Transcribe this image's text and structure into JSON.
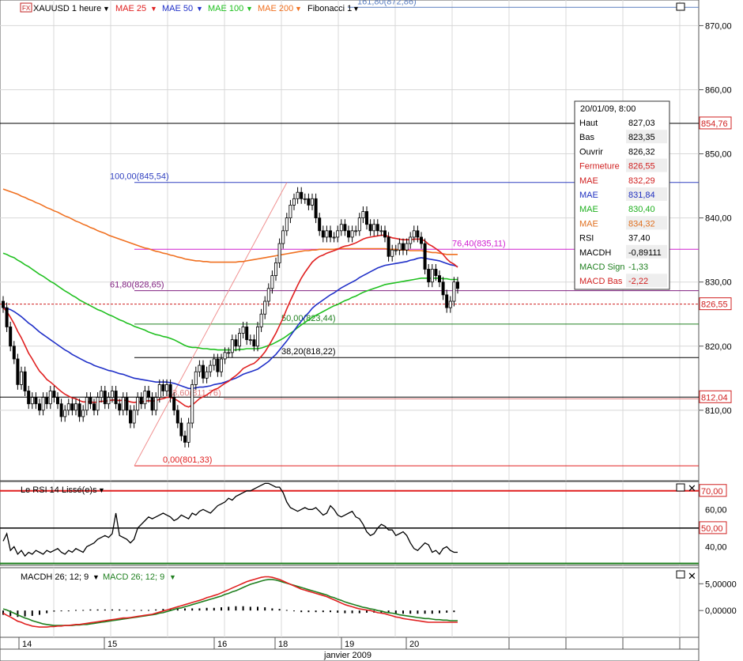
{
  "header": {
    "instrument": "XAUUSD 1 heure",
    "indicators": [
      {
        "label": "MAE 25",
        "color": "#e02020"
      },
      {
        "label": "MAE 50",
        "color": "#2030c8"
      },
      {
        "label": "MAE 100",
        "color": "#20c020"
      },
      {
        "label": "MAE 200",
        "color": "#f07020"
      },
      {
        "label": "Fibonacci 1",
        "color": "#000000"
      }
    ]
  },
  "fibonacci": [
    {
      "label": "161,80(872,86)",
      "price": 872.86,
      "color": "#5a7ec0"
    },
    {
      "label": "100,00(845,54)",
      "price": 845.54,
      "color": "#3040c0"
    },
    {
      "label": "76,40(835,11)",
      "price": 835.11,
      "color": "#d020d0"
    },
    {
      "label": "61,80(828,65)",
      "price": 828.65,
      "color": "#802080"
    },
    {
      "label": "50,00(823,44)",
      "price": 823.44,
      "color": "#208020"
    },
    {
      "label": "38,20(818,22)",
      "price": 818.22,
      "color": "#000000"
    },
    {
      "label": "23,60(811,76)",
      "price": 811.76,
      "color": "#e08080"
    },
    {
      "label": "0,00(801,33)",
      "price": 801.33,
      "color": "#e02020"
    }
  ],
  "price_markers": [
    {
      "label": "854,76",
      "price": 854.76
    },
    {
      "label": "826,55",
      "price": 826.55
    },
    {
      "label": "812,04",
      "price": 812.04
    }
  ],
  "info_box": {
    "title": "20/01/09, 8:00",
    "rows": [
      {
        "label": "Haut",
        "value": "827,03",
        "color": "#000000"
      },
      {
        "label": "Bas",
        "value": "823,35",
        "color": "#000000"
      },
      {
        "label": "Ouvrir",
        "value": "826,32",
        "color": "#000000"
      },
      {
        "label": "Fermeture",
        "value": "826,55",
        "color": "#d02020"
      },
      {
        "label": "MAE",
        "value": "832,29",
        "color": "#d02020"
      },
      {
        "label": "MAE",
        "value": "831,84",
        "color": "#2030c0"
      },
      {
        "label": "MAE",
        "value": "830,40",
        "color": "#20b020"
      },
      {
        "label": "MAE",
        "value": "834,32",
        "color": "#e07020"
      },
      {
        "label": "RSI",
        "value": "37,40",
        "color": "#000000"
      },
      {
        "label": "MACDH",
        "value": "-0,89111",
        "color": "#000000"
      },
      {
        "label": "MACD Sign",
        "value": "-1,33",
        "color": "#208020"
      },
      {
        "label": "MACD Bas",
        "value": "-2,22",
        "color": "#d02020"
      }
    ]
  },
  "rsi_panel": {
    "title": "Le RSI 14 Lissé(e)s",
    "markers": [
      {
        "label": "70,00",
        "value": 70
      },
      {
        "label": "50,00",
        "value": 50
      }
    ],
    "ticks": [
      {
        "label": "60,00",
        "value": 60
      },
      {
        "label": "40,00",
        "value": 40
      }
    ]
  },
  "macd_panel": {
    "title_h": "MACDH 26; 12; 9",
    "title_m": "MACD 26; 12; 9",
    "ticks": [
      {
        "label": "5,00000",
        "value": 5
      },
      {
        "label": "0,00000",
        "value": 0
      }
    ]
  },
  "x_axis": {
    "days": [
      {
        "label": "14",
        "hour": 0
      },
      {
        "label": "15",
        "hour": 24
      },
      {
        "label": "16",
        "hour": 48
      },
      {
        "label": "18",
        "hour": 72
      },
      {
        "label": "19",
        "hour": 96
      },
      {
        "label": "20",
        "hour": 120
      }
    ],
    "month_label": "janvier 2009"
  },
  "chart_data": {
    "type": "candlestick",
    "price_ticks": [
      810,
      820,
      830,
      840,
      850,
      860,
      870
    ],
    "price_tick_labels": [
      "810,00",
      "820,00",
      "830,00",
      "840,00",
      "850,00",
      "860,00",
      "870,00"
    ],
    "price_range": [
      799,
      874
    ],
    "close": [
      826,
      823,
      820,
      818,
      814,
      816,
      813,
      811,
      812,
      811,
      810,
      812,
      811,
      813,
      812,
      811,
      809,
      810,
      811,
      810,
      811,
      809,
      810,
      812,
      811,
      810,
      812,
      813,
      811,
      812,
      813,
      811,
      810,
      812,
      810,
      808,
      810,
      812,
      811,
      813,
      812,
      810,
      812,
      814,
      813,
      814,
      812,
      810,
      808,
      806,
      805,
      808,
      814,
      816,
      817,
      815,
      816,
      817,
      818,
      816,
      818,
      819,
      819,
      821,
      820,
      822,
      823,
      821,
      821,
      820,
      823,
      825,
      827,
      829,
      831,
      833,
      836,
      838,
      840,
      842,
      843,
      844,
      843,
      843,
      842,
      843,
      840,
      838,
      837,
      838,
      837,
      837,
      838,
      839,
      838,
      837,
      838,
      838,
      840,
      841,
      839,
      838,
      839,
      838,
      838,
      837,
      834,
      835,
      835,
      836,
      835,
      836,
      837,
      838,
      837,
      836,
      832,
      830,
      832,
      831,
      830,
      828,
      826,
      827,
      830,
      829
    ],
    "ema25": [
      826,
      825.4,
      824.5,
      823.5,
      822.3,
      821.3,
      820.1,
      818.9,
      818.0,
      817.0,
      816.1,
      815.5,
      814.8,
      814.4,
      813.9,
      813.4,
      812.9,
      812.5,
      812.2,
      811.9,
      811.8,
      811.5,
      811.3,
      811.3,
      811.3,
      811.2,
      811.3,
      811.4,
      811.4,
      811.5,
      811.6,
      811.6,
      811.5,
      811.6,
      811.5,
      811.3,
      811.2,
      811.3,
      811.3,
      811.4,
      811.5,
      811.4,
      811.5,
      811.7,
      811.8,
      812.0,
      812.0,
      811.8,
      811.5,
      811.1,
      810.7,
      810.5,
      810.8,
      811.3,
      811.8,
      812.1,
      812.4,
      812.8,
      813.2,
      813.4,
      813.8,
      814.2,
      814.5,
      815.0,
      815.4,
      815.9,
      816.5,
      816.8,
      817.1,
      817.3,
      817.8,
      818.4,
      819.1,
      820.0,
      821.0,
      822.0,
      823.2,
      824.4,
      825.8,
      827.1,
      828.3,
      829.5,
      830.6,
      831.5,
      832.3,
      833.1,
      833.6,
      834.0,
      834.2,
      834.5,
      834.7,
      834.9,
      835.1,
      835.4,
      835.6,
      835.7,
      835.9,
      836.1,
      836.4,
      836.7,
      836.9,
      837.0,
      837.1,
      837.2,
      837.3,
      837.3,
      837.1,
      836.9,
      836.8,
      836.7,
      836.6,
      836.6,
      836.6,
      836.7,
      836.7,
      836.7,
      836.4,
      835.9,
      835.6,
      835.2,
      834.8,
      834.3,
      833.6,
      833.1,
      832.8,
      832.3
    ],
    "ema50": [
      826,
      825.9,
      825.7,
      825.4,
      825.0,
      824.6,
      824.1,
      823.6,
      823.2,
      822.7,
      822.2,
      821.8,
      821.4,
      821.0,
      820.6,
      820.2,
      819.8,
      819.4,
      819.1,
      818.7,
      818.4,
      818.1,
      817.8,
      817.5,
      817.3,
      817.0,
      816.8,
      816.6,
      816.4,
      816.2,
      816.1,
      815.9,
      815.7,
      815.6,
      815.4,
      815.2,
      815.0,
      814.9,
      814.8,
      814.7,
      814.6,
      814.5,
      814.4,
      814.4,
      814.4,
      814.4,
      814.3,
      814.2,
      814.0,
      813.8,
      813.6,
      813.4,
      813.4,
      813.5,
      813.6,
      813.6,
      813.7,
      813.8,
      814.0,
      814.1,
      814.2,
      814.4,
      814.6,
      814.8,
      815.0,
      815.3,
      815.6,
      815.8,
      816.0,
      816.2,
      816.4,
      816.8,
      817.2,
      817.6,
      818.2,
      818.7,
      819.4,
      820.1,
      820.8,
      821.6,
      822.4,
      823.2,
      823.9,
      824.6,
      825.2,
      825.9,
      826.4,
      826.8,
      827.2,
      827.6,
      828.0,
      828.3,
      828.7,
      829.1,
      829.4,
      829.7,
      830.0,
      830.3,
      830.7,
      831.0,
      831.3,
      831.6,
      831.9,
      832.2,
      832.4,
      832.6,
      832.7,
      832.8,
      832.9,
      833.0,
      833.1,
      833.2,
      833.4,
      833.5,
      833.7,
      833.8,
      833.7,
      833.6,
      833.5,
      833.4,
      833.3,
      833.1,
      832.9,
      832.7,
      832.6,
      832.4
    ],
    "ema100": [
      834.5,
      834.3,
      834.0,
      833.8,
      833.4,
      833.1,
      832.7,
      832.4,
      832.0,
      831.6,
      831.2,
      830.9,
      830.5,
      830.1,
      829.8,
      829.4,
      829.0,
      828.6,
      828.3,
      827.9,
      827.6,
      827.2,
      826.9,
      826.6,
      826.3,
      826.0,
      825.7,
      825.5,
      825.2,
      824.9,
      824.7,
      824.4,
      824.1,
      823.9,
      823.6,
      823.4,
      823.1,
      822.9,
      822.7,
      822.5,
      822.2,
      822.0,
      821.8,
      821.7,
      821.5,
      821.4,
      821.2,
      821.0,
      820.7,
      820.4,
      820.1,
      819.9,
      819.8,
      819.8,
      819.7,
      819.6,
      819.6,
      819.5,
      819.5,
      819.4,
      819.4,
      819.4,
      819.4,
      819.4,
      819.4,
      819.5,
      819.5,
      819.6,
      819.6,
      819.6,
      819.6,
      819.7,
      819.9,
      820.1,
      820.3,
      820.6,
      820.9,
      821.2,
      821.6,
      822.0,
      822.4,
      822.9,
      823.3,
      823.7,
      824.1,
      824.5,
      824.8,
      825.1,
      825.4,
      825.7,
      826.0,
      826.3,
      826.5,
      826.8,
      827.1,
      827.3,
      827.6,
      827.8,
      828.1,
      828.4,
      828.6,
      828.8,
      829.0,
      829.2,
      829.4,
      829.6,
      829.7,
      829.8,
      829.9,
      830.0,
      830.1,
      830.2,
      830.3,
      830.4,
      830.5,
      830.6,
      830.6,
      830.6,
      830.6,
      830.6,
      830.6,
      830.5,
      830.5,
      830.4,
      830.4,
      830.4
    ],
    "ema200": [
      844.5,
      844.3,
      844.1,
      843.9,
      843.7,
      843.4,
      843.2,
      842.9,
      842.7,
      842.4,
      842.2,
      841.9,
      841.6,
      841.4,
      841.1,
      840.9,
      840.6,
      840.3,
      840.1,
      839.8,
      839.5,
      839.3,
      839.0,
      838.8,
      838.5,
      838.3,
      838.0,
      837.8,
      837.6,
      837.3,
      837.1,
      836.9,
      836.7,
      836.5,
      836.3,
      836.1,
      835.9,
      835.7,
      835.5,
      835.3,
      835.2,
      835.0,
      834.8,
      834.7,
      834.5,
      834.4,
      834.2,
      834.1,
      833.9,
      833.8,
      833.6,
      833.5,
      833.4,
      833.3,
      833.3,
      833.2,
      833.2,
      833.1,
      833.1,
      833.1,
      833.1,
      833.1,
      833.1,
      833.1,
      833.1,
      833.2,
      833.2,
      833.3,
      833.4,
      833.5,
      833.6,
      833.7,
      833.8,
      833.9,
      834.0,
      834.1,
      834.2,
      834.3,
      834.4,
      834.5,
      834.6,
      834.7,
      834.8,
      834.9,
      834.9,
      835.0,
      835.0,
      835.1,
      835.1,
      835.1,
      835.1,
      835.1,
      835.2,
      835.2,
      835.2,
      835.2,
      835.2,
      835.2,
      835.2,
      835.2,
      835.2,
      835.2,
      835.2,
      835.2,
      835.2,
      835.2,
      835.1,
      835.1,
      835.1,
      835.0,
      835.0,
      835.0,
      834.9,
      834.9,
      834.9,
      834.9,
      834.8,
      834.7,
      834.6,
      834.6,
      834.5,
      834.4,
      834.3,
      834.3,
      834.3,
      834.3
    ],
    "rsi": [
      43,
      47,
      38,
      40,
      36,
      38,
      35,
      37,
      36,
      38,
      37,
      36,
      38,
      37,
      38,
      39,
      37,
      36,
      38,
      37,
      39,
      38,
      37,
      40,
      41,
      42,
      44,
      45,
      46,
      45,
      47,
      58,
      46,
      45,
      44,
      42,
      44,
      50,
      52,
      54,
      56,
      55,
      56,
      57,
      58,
      57,
      56,
      54,
      55,
      57,
      56,
      55,
      58,
      57,
      59,
      60,
      59,
      58,
      60,
      62,
      63,
      64,
      66,
      65,
      67,
      68,
      69,
      70,
      70,
      71,
      72,
      73,
      74,
      74,
      73,
      72,
      72,
      69,
      64,
      61,
      60,
      59,
      60,
      61,
      60,
      60,
      61,
      59,
      57,
      58,
      62,
      60,
      57,
      56,
      57,
      58,
      59,
      56,
      55,
      52,
      48,
      46,
      47,
      50,
      52,
      51,
      49,
      49,
      46,
      47,
      48,
      46,
      42,
      39,
      38,
      40,
      42,
      41,
      37,
      38,
      36,
      39,
      40,
      38,
      37,
      37
    ],
    "macd": [
      -0.5,
      -0.9,
      -1.2,
      -1.6,
      -2.0,
      -2.2,
      -2.5,
      -2.7,
      -2.9,
      -3.0,
      -3.1,
      -3.1,
      -3.1,
      -3.0,
      -3.0,
      -2.9,
      -2.9,
      -2.8,
      -2.8,
      -2.7,
      -2.6,
      -2.6,
      -2.5,
      -2.4,
      -2.3,
      -2.2,
      -2.1,
      -2.0,
      -1.9,
      -1.8,
      -1.7,
      -1.6,
      -1.5,
      -1.4,
      -1.4,
      -1.3,
      -1.2,
      -1.1,
      -1.0,
      -0.9,
      -0.8,
      -0.7,
      -0.5,
      -0.3,
      -0.1,
      0.1,
      0.3,
      0.5,
      0.7,
      0.9,
      1.1,
      1.3,
      1.5,
      1.7,
      1.9,
      2.1,
      2.4,
      2.6,
      2.8,
      3.0,
      3.3,
      3.6,
      3.9,
      4.2,
      4.5,
      4.8,
      5.1,
      5.4,
      5.6,
      5.8,
      6.0,
      6.2,
      6.3,
      6.3,
      6.2,
      6.0,
      5.8,
      5.5,
      5.2,
      4.9,
      4.6,
      4.3,
      4.0,
      3.8,
      3.6,
      3.4,
      3.2,
      3.0,
      2.8,
      2.6,
      2.3,
      2.0,
      1.7,
      1.4,
      1.1,
      0.9,
      0.7,
      0.5,
      0.3,
      0.2,
      0.1,
      0.0,
      -0.2,
      -0.4,
      -0.5,
      -0.6,
      -0.8,
      -1.0,
      -1.2,
      -1.3,
      -1.5,
      -1.6,
      -1.7,
      -1.8,
      -1.9,
      -2.0,
      -2.1,
      -2.2,
      -2.2,
      -2.2,
      -2.2,
      -2.2,
      -2.2,
      -2.2,
      -2.2,
      -2.2
    ],
    "macd_signal": [
      0.3,
      0.1,
      -0.2,
      -0.5,
      -0.8,
      -1.1,
      -1.4,
      -1.6,
      -1.9,
      -2.1,
      -2.3,
      -2.5,
      -2.6,
      -2.7,
      -2.8,
      -2.8,
      -2.8,
      -2.8,
      -2.8,
      -2.8,
      -2.7,
      -2.7,
      -2.6,
      -2.6,
      -2.5,
      -2.4,
      -2.3,
      -2.2,
      -2.1,
      -2.0,
      -1.9,
      -1.8,
      -1.7,
      -1.6,
      -1.5,
      -1.4,
      -1.3,
      -1.2,
      -1.1,
      -1.0,
      -0.9,
      -0.8,
      -0.7,
      -0.5,
      -0.4,
      -0.2,
      0.0,
      0.2,
      0.4,
      0.5,
      0.7,
      0.9,
      1.1,
      1.3,
      1.5,
      1.7,
      1.9,
      2.1,
      2.3,
      2.5,
      2.7,
      3.0,
      3.2,
      3.5,
      3.7,
      4.0,
      4.3,
      4.6,
      4.9,
      5.1,
      5.3,
      5.5,
      5.7,
      5.8,
      5.8,
      5.7,
      5.5,
      5.3,
      5.1,
      4.9,
      4.7,
      4.5,
      4.3,
      4.1,
      3.9,
      3.7,
      3.5,
      3.3,
      3.1,
      2.9,
      2.6,
      2.4,
      2.1,
      1.9,
      1.6,
      1.4,
      1.2,
      1.0,
      0.8,
      0.6,
      0.5,
      0.3,
      0.2,
      0.0,
      -0.1,
      -0.3,
      -0.4,
      -0.5,
      -0.6,
      -0.8,
      -0.9,
      -1.0,
      -1.1,
      -1.2,
      -1.3,
      -1.4,
      -1.5,
      -1.5,
      -1.6,
      -1.7,
      -1.7,
      -1.8,
      -1.8,
      -1.9,
      -1.9,
      -1.9
    ]
  }
}
